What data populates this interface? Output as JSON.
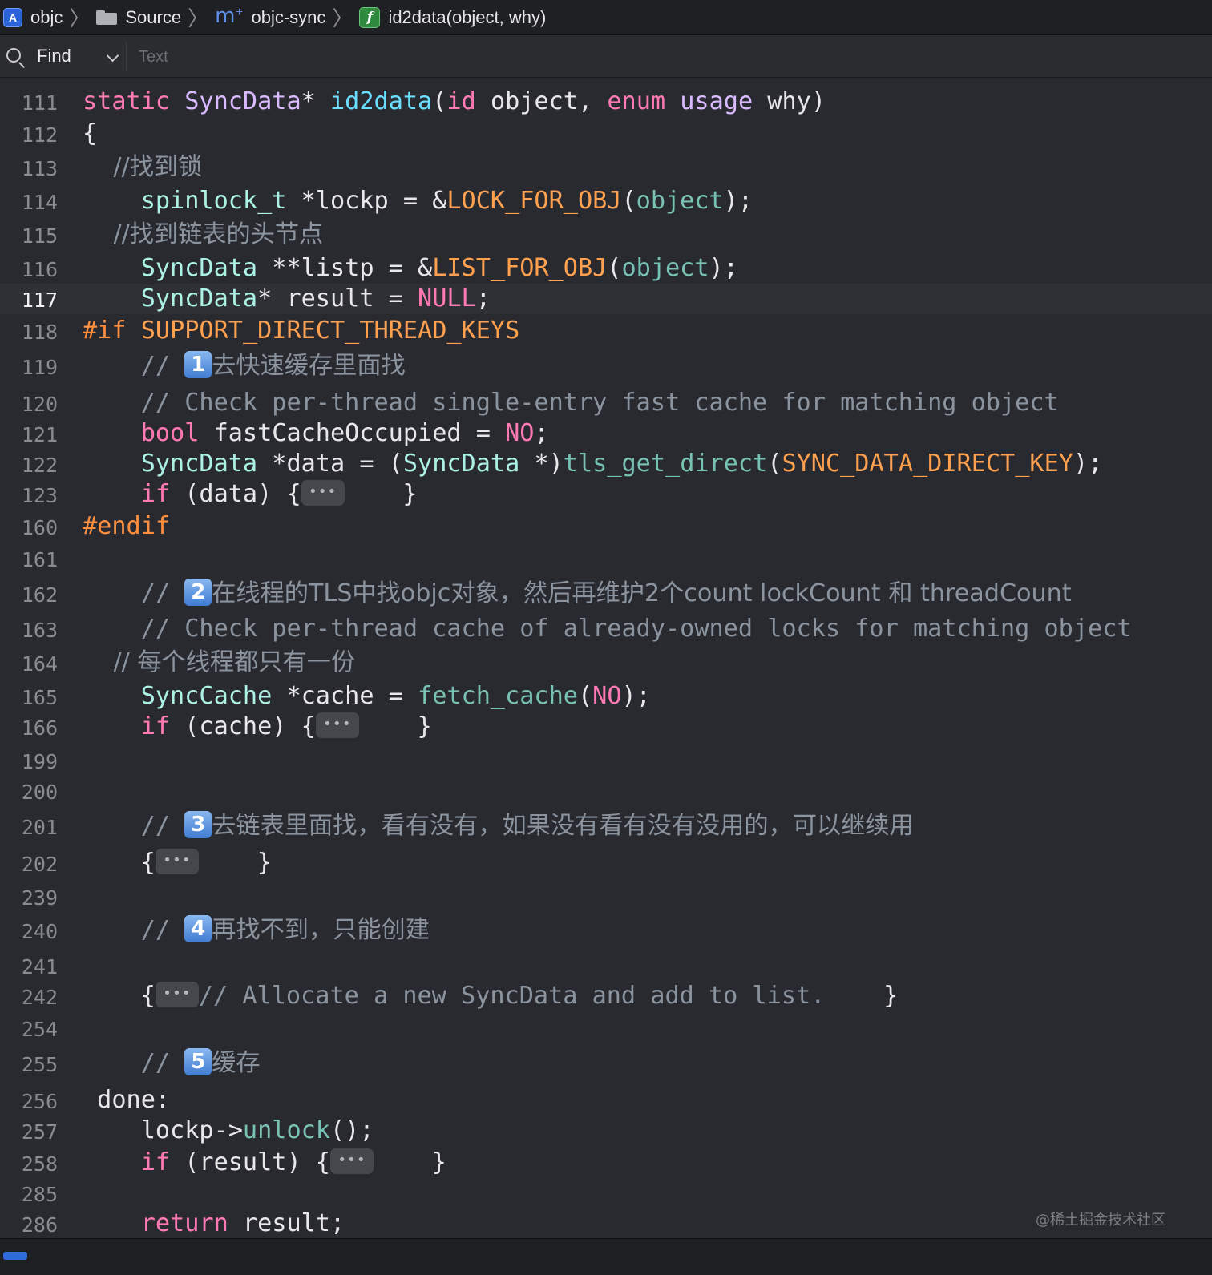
{
  "breadcrumb": {
    "project": "objc",
    "folder": "Source",
    "file": "objc-sync",
    "symbol": "id2data(object, why)",
    "separator": "〉"
  },
  "find": {
    "mode": "Find",
    "placeholder": "Text"
  },
  "fold_glyph": "•••",
  "watermark": "@稀土掘金技术社区",
  "colors": {
    "background": "#292a30",
    "keyword": "#ff7ab2",
    "type": "#dabaff",
    "comment": "#8b949e",
    "function": "#6bdfff",
    "macro": "#ffa14f"
  },
  "lines": [
    {
      "num": "111",
      "tokens": [
        [
          "kw",
          "static"
        ],
        [
          "p",
          " "
        ],
        [
          "ty",
          "SyncData"
        ],
        [
          "p",
          "* "
        ],
        [
          "fn",
          "id2data"
        ],
        [
          "p",
          "("
        ],
        [
          "kw",
          "id"
        ],
        [
          "p",
          " object, "
        ],
        [
          "kw",
          "enum"
        ],
        [
          "p",
          " "
        ],
        [
          "ty",
          "usage"
        ],
        [
          "p",
          " why)"
        ]
      ]
    },
    {
      "num": "112",
      "tokens": [
        [
          "p",
          "{"
        ]
      ]
    },
    {
      "num": "113",
      "tokens": [
        [
          "cm",
          "    //找到锁"
        ]
      ]
    },
    {
      "num": "114",
      "tokens": [
        [
          "p",
          "    "
        ],
        [
          "tyg",
          "spinlock_t"
        ],
        [
          "p",
          " *lockp = &"
        ],
        [
          "mc",
          "LOCK_FOR_OBJ"
        ],
        [
          "p",
          "("
        ],
        [
          "fng",
          "object"
        ],
        [
          "p",
          ");"
        ]
      ]
    },
    {
      "num": "115",
      "tokens": [
        [
          "cm",
          "    //找到链表的头节点"
        ]
      ]
    },
    {
      "num": "116",
      "tokens": [
        [
          "p",
          "    "
        ],
        [
          "tyg",
          "SyncData"
        ],
        [
          "p",
          " **listp = &"
        ],
        [
          "mc",
          "LIST_FOR_OBJ"
        ],
        [
          "p",
          "("
        ],
        [
          "fng",
          "object"
        ],
        [
          "p",
          ");"
        ]
      ]
    },
    {
      "num": "117",
      "current": true,
      "tokens": [
        [
          "p",
          "    "
        ],
        [
          "tyg",
          "SyncData"
        ],
        [
          "p",
          "* result = "
        ],
        [
          "kw",
          "NULL"
        ],
        [
          "p",
          ";"
        ]
      ]
    },
    {
      "num": "118",
      "tokens": [
        [
          "pp",
          "#if"
        ],
        [
          "p",
          " "
        ],
        [
          "mc",
          "SUPPORT_DIRECT_THREAD_KEYS"
        ]
      ]
    },
    {
      "num": "119",
      "tokens": [
        [
          "cm",
          "    // "
        ],
        [
          "badge",
          "1"
        ],
        [
          "cm",
          "去快速缓存里面找"
        ]
      ]
    },
    {
      "num": "120",
      "tokens": [
        [
          "cm",
          "    // Check per-thread single-entry fast cache for matching object"
        ]
      ]
    },
    {
      "num": "121",
      "tokens": [
        [
          "p",
          "    "
        ],
        [
          "kw",
          "bool"
        ],
        [
          "p",
          " fastCacheOccupied = "
        ],
        [
          "kw",
          "NO"
        ],
        [
          "p",
          ";"
        ]
      ]
    },
    {
      "num": "122",
      "tokens": [
        [
          "p",
          "    "
        ],
        [
          "tyg",
          "SyncData"
        ],
        [
          "p",
          " *data = ("
        ],
        [
          "tyg",
          "SyncData"
        ],
        [
          "p",
          " *)"
        ],
        [
          "fng",
          "tls_get_direct"
        ],
        [
          "p",
          "("
        ],
        [
          "mc",
          "SYNC_DATA_DIRECT_KEY"
        ],
        [
          "p",
          ");"
        ]
      ]
    },
    {
      "num": "123",
      "tokens": [
        [
          "p",
          "    "
        ],
        [
          "kw",
          "if"
        ],
        [
          "p",
          " (data) {"
        ],
        [
          "fold",
          ""
        ],
        [
          "p",
          "    }"
        ]
      ]
    },
    {
      "num": "160",
      "tokens": [
        [
          "pp",
          "#endif"
        ]
      ]
    },
    {
      "num": "161",
      "tokens": []
    },
    {
      "num": "162",
      "tokens": [
        [
          "cm",
          "    // "
        ],
        [
          "badge",
          "2"
        ],
        [
          "cm",
          "在线程的TLS中找objc对象，然后再维护2个count lockCount 和 threadCount"
        ]
      ]
    },
    {
      "num": "163",
      "tokens": [
        [
          "cm",
          "    // Check per-thread cache of already-owned locks for matching object"
        ]
      ]
    },
    {
      "num": "164",
      "tokens": [
        [
          "cm",
          "    // 每个线程都只有一份"
        ]
      ]
    },
    {
      "num": "165",
      "tokens": [
        [
          "p",
          "    "
        ],
        [
          "tyg",
          "SyncCache"
        ],
        [
          "p",
          " *cache = "
        ],
        [
          "fng",
          "fetch_cache"
        ],
        [
          "p",
          "("
        ],
        [
          "kw",
          "NO"
        ],
        [
          "p",
          ");"
        ]
      ]
    },
    {
      "num": "166",
      "tokens": [
        [
          "p",
          "    "
        ],
        [
          "kw",
          "if"
        ],
        [
          "p",
          " (cache) {"
        ],
        [
          "fold",
          ""
        ],
        [
          "p",
          "    }"
        ]
      ]
    },
    {
      "num": "199",
      "tokens": []
    },
    {
      "num": "200",
      "tokens": []
    },
    {
      "num": "201",
      "tokens": [
        [
          "cm",
          "    // "
        ],
        [
          "badge",
          "3"
        ],
        [
          "cm",
          "去链表里面找，看有没有，如果没有看有没有没用的，可以继续用"
        ]
      ]
    },
    {
      "num": "202",
      "tokens": [
        [
          "p",
          "    {"
        ],
        [
          "fold",
          ""
        ],
        [
          "p",
          "    }"
        ]
      ]
    },
    {
      "num": "239",
      "tokens": []
    },
    {
      "num": "240",
      "tokens": [
        [
          "cm",
          "    // "
        ],
        [
          "badge",
          "4"
        ],
        [
          "cm",
          "再找不到，只能创建"
        ]
      ]
    },
    {
      "num": "241",
      "tokens": []
    },
    {
      "num": "242",
      "tokens": [
        [
          "p",
          "    {"
        ],
        [
          "fold",
          ""
        ],
        [
          "cm",
          "// Allocate a new SyncData and add to list."
        ],
        [
          "p",
          "    }"
        ]
      ]
    },
    {
      "num": "254",
      "tokens": []
    },
    {
      "num": "255",
      "tokens": [
        [
          "cm",
          "    // "
        ],
        [
          "badge",
          "5"
        ],
        [
          "cm",
          "缓存"
        ]
      ]
    },
    {
      "num": "256",
      "tokens": [
        [
          "p",
          " done:"
        ]
      ]
    },
    {
      "num": "257",
      "tokens": [
        [
          "p",
          "    lockp->"
        ],
        [
          "fng",
          "unlock"
        ],
        [
          "p",
          "();"
        ]
      ]
    },
    {
      "num": "258",
      "tokens": [
        [
          "p",
          "    "
        ],
        [
          "kw",
          "if"
        ],
        [
          "p",
          " (result) {"
        ],
        [
          "fold",
          ""
        ],
        [
          "p",
          "    }"
        ]
      ]
    },
    {
      "num": "285",
      "tokens": []
    },
    {
      "num": "286",
      "tokens": [
        [
          "p",
          "    "
        ],
        [
          "kw",
          "return"
        ],
        [
          "p",
          " result;"
        ]
      ]
    }
  ]
}
